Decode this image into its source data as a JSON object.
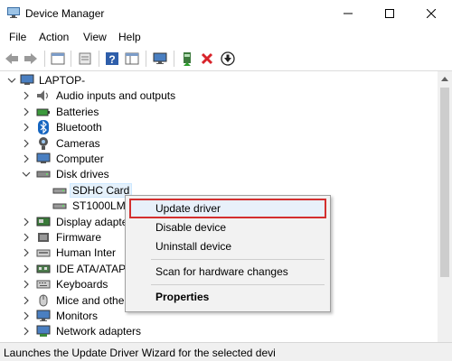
{
  "window": {
    "title": "Device Manager"
  },
  "menubar": [
    "File",
    "Action",
    "View",
    "Help"
  ],
  "toolbar": {
    "icons": [
      "back-icon",
      "forward-icon",
      "properties-sheet-icon",
      "show-hidden-icon",
      "help-icon",
      "view-pane-icon",
      "monitor-scan-icon",
      "add-driver-icon",
      "uninstall-x-icon",
      "disable-device-icon"
    ]
  },
  "tree": {
    "root": "LAPTOP-",
    "items": [
      {
        "label": "Audio inputs and outputs",
        "icon": "speaker-icon"
      },
      {
        "label": "Batteries",
        "icon": "battery-icon"
      },
      {
        "label": "Bluetooth",
        "icon": "bluetooth-icon"
      },
      {
        "label": "Cameras",
        "icon": "camera-icon"
      },
      {
        "label": "Computer",
        "icon": "computer-icon"
      },
      {
        "label": "Disk drives",
        "icon": "disk-drive-icon",
        "expanded": true,
        "children": [
          {
            "label": "SDHC Card"
          },
          {
            "label": "ST1000LM0"
          }
        ]
      },
      {
        "label": "Display adapte",
        "icon": "display-adapter-icon"
      },
      {
        "label": "Firmware",
        "icon": "firmware-icon"
      },
      {
        "label": "Human Inter",
        "icon": "hid-icon"
      },
      {
        "label": "IDE ATA/ATAPI",
        "icon": "ide-controller-icon"
      },
      {
        "label": "Keyboards",
        "icon": "keyboard-icon"
      },
      {
        "label": "Mice and other",
        "icon": "mouse-icon"
      },
      {
        "label": "Monitors",
        "icon": "monitor-icon"
      },
      {
        "label": "Network adapters",
        "icon": "network-adapter-icon"
      }
    ]
  },
  "context_menu": {
    "update": "Update driver",
    "disable": "Disable device",
    "uninstall": "Uninstall device",
    "scan": "Scan for hardware changes",
    "properties": "Properties"
  },
  "status": "Launches the Update Driver Wizard for the selected devi",
  "colors": {
    "highlight_border": "#d32f2f",
    "selection_bg": "#e5f1fb"
  }
}
